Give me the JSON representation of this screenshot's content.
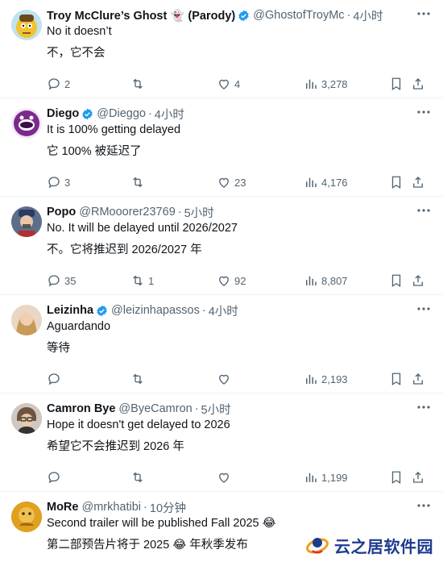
{
  "tweets": [
    {
      "name": "Troy McClure’s Ghost 👻 (Parody)",
      "verified": true,
      "handle": "@GhostofTroyMc",
      "time": "4小时",
      "text": "No it doesn’t",
      "translation": "不，它不会",
      "replies": "2",
      "retweets": "",
      "likes": "4",
      "views": "3,278",
      "avatar_color": "#f2c230"
    },
    {
      "name": "Diego",
      "verified": true,
      "handle": "@Dieggo",
      "time": "4小时",
      "text": "It is 100% getting delayed",
      "translation": "它 100% 被延迟了",
      "replies": "3",
      "retweets": "",
      "likes": "23",
      "views": "4,176",
      "avatar_color": "#7b2a8c"
    },
    {
      "name": "Popo",
      "verified": false,
      "handle": "@RMooorer23769",
      "time": "5小时",
      "text": "No. It will be delayed until 2026/2027",
      "translation": "不。它将推迟到 2026/2027 年",
      "replies": "35",
      "retweets": "1",
      "likes": "92",
      "views": "8,807",
      "avatar_color": "#3b5fa0"
    },
    {
      "name": "Leizinha",
      "verified": true,
      "handle": "@leizinhapassos",
      "time": "4小时",
      "text": "Aguardando",
      "translation": "等待",
      "replies": "",
      "retweets": "",
      "likes": "",
      "views": "2,193",
      "avatar_color": "#d9b48a"
    },
    {
      "name": "Camron Bye",
      "verified": false,
      "handle": "@ByeCamron",
      "time": "5小时",
      "text": "Hope it doesn't get delayed to 2026",
      "translation": "希望它不会推迟到 2026 年",
      "replies": "",
      "retweets": "",
      "likes": "",
      "views": "1,199",
      "avatar_color": "#8a7a70"
    },
    {
      "name": "MoRe",
      "verified": false,
      "handle": "@mrkhatibi",
      "time": "10分钟",
      "text": "Second trailer will be published Fall 2025 😂",
      "translation": "第二部预告片将于 2025 😂 年秋季发布",
      "replies": "",
      "retweets": "",
      "likes": "",
      "views": "",
      "avatar_color": "#e0a020"
    }
  ],
  "colors": {
    "accent": "#1d9bf0",
    "muted": "#536471",
    "text": "#0f1419",
    "divider": "#eff3f4"
  },
  "watermark": {
    "text": "云之居软件园"
  }
}
